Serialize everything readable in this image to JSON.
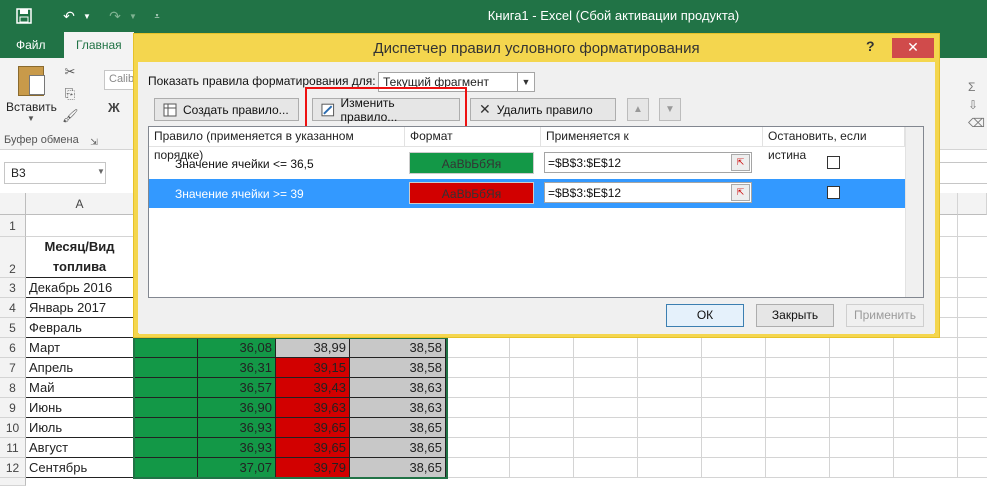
{
  "window": {
    "title": "Книга1 - Excel (Сбой активации продукта)"
  },
  "ribbon": {
    "tabs": [
      "Файл",
      "Главная"
    ],
    "paste_label": "Вставить",
    "clipboard_group": "Буфер обмена",
    "font_name_partial": "Calib",
    "bold_glyph": "Ж"
  },
  "formula_bar": {
    "name_box": "B3"
  },
  "sheet": {
    "columns": [
      "A"
    ],
    "rows": [
      {
        "num": "1",
        "a": "",
        "c": "",
        "d": "",
        "e": "",
        "fill": ""
      },
      {
        "num": "2",
        "a": "Месяц/Вид топлива",
        "c": "",
        "d": "",
        "e": "",
        "fill": ""
      },
      {
        "num": "3",
        "a": "Декабрь 2016",
        "c": "",
        "d": "",
        "e": "",
        "fill": ""
      },
      {
        "num": "4",
        "a": "Январь 2017",
        "c": "",
        "d": "",
        "e": "",
        "fill": ""
      },
      {
        "num": "5",
        "a": "Февраль",
        "c": "",
        "d": "",
        "e": "",
        "fill": ""
      },
      {
        "num": "6",
        "a": "Март",
        "c": "36,08",
        "d": "38,99",
        "e": "38,58",
        "fill": "grey"
      },
      {
        "num": "7",
        "a": "Апрель",
        "c": "36,31",
        "d": "39,15",
        "e": "38,58",
        "fill": "red"
      },
      {
        "num": "8",
        "a": "Май",
        "c": "36,57",
        "d": "39,43",
        "e": "38,63",
        "fill": "red"
      },
      {
        "num": "9",
        "a": "Июнь",
        "c": "36,90",
        "d": "39,63",
        "e": "38,63",
        "fill": "red"
      },
      {
        "num": "10",
        "a": "Июль",
        "c": "36,93",
        "d": "39,65",
        "e": "38,65",
        "fill": "red"
      },
      {
        "num": "11",
        "a": "Август",
        "c": "36,93",
        "d": "39,65",
        "e": "38,65",
        "fill": "red"
      },
      {
        "num": "12",
        "a": "Сентябрь",
        "c": "37,07",
        "d": "39,79",
        "e": "38,65",
        "fill": "red"
      }
    ]
  },
  "dialog": {
    "title": "Диспетчер правил условного форматирования",
    "help": "?",
    "close": "✕",
    "show_rules_label": "Показать правила форматирования для:",
    "scope_value": "Текущий фрагмент",
    "buttons": {
      "new_rule": "Создать правило...",
      "edit_rule": "Изменить правило...",
      "delete_rule": "Удалить правило",
      "ok": "ОК",
      "close": "Закрыть",
      "apply": "Применить"
    },
    "table_headers": {
      "rule": "Правило (применяется в указанном порядке)",
      "format": "Формат",
      "applies_to": "Применяется к",
      "stop_if_true": "Остановить, если истина"
    },
    "rules": [
      {
        "rule": "Значение ячейки <= 36,5",
        "format_preview": "АаВbБбЯя",
        "format_color": "#139847",
        "applies_to": "=$B$3:$E$12",
        "selected": false
      },
      {
        "rule": "Значение ячейки >= 39",
        "format_preview": "АаВbБбЯя",
        "format_color": "#d20000",
        "applies_to": "=$B$3:$E$12",
        "selected": true
      }
    ]
  },
  "colors": {
    "excel_green": "#217346",
    "dialog_accent": "#f4d64e",
    "selection_blue": "#3399ff"
  }
}
